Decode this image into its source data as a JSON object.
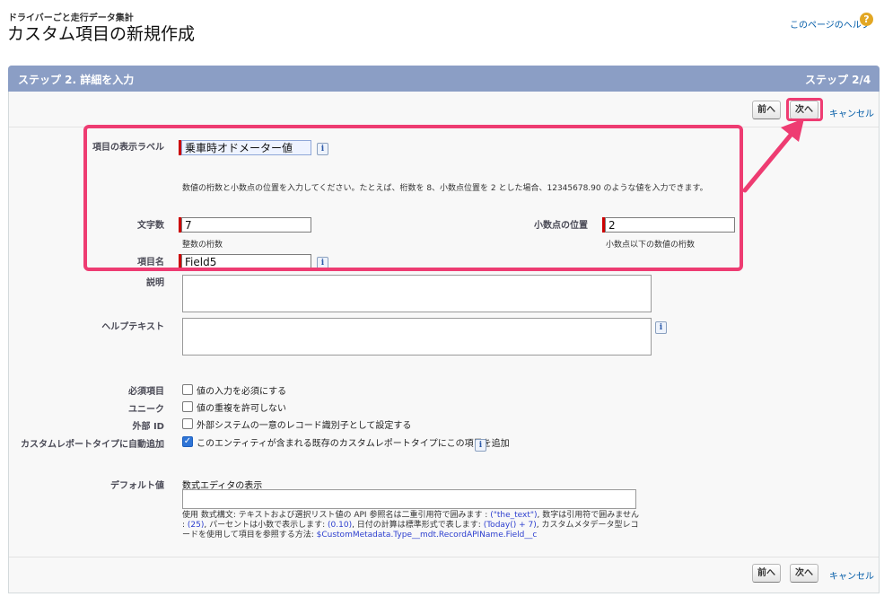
{
  "header": {
    "breadcrumb": "ドライバーごと走行データ集計",
    "title": "カスタム項目の新規作成",
    "help_link": "このページのヘルプ",
    "help_icon": "?"
  },
  "step": {
    "title": "ステップ 2. 詳細を入力",
    "counter": "ステップ 2/4"
  },
  "buttons": {
    "prev": "前へ",
    "next": "次へ",
    "cancel": "キャンセル"
  },
  "form": {
    "field_label": {
      "label": "項目の表示ラベル",
      "value": "乗車時オドメーター値"
    },
    "instruction": "数値の桁数と小数点の位置を入力してください。たとえば、桁数を 8、小数点位置を 2 とした場合、12345678.90 のような値を入力できます。",
    "length": {
      "label": "文字数",
      "value": "7",
      "note": "整数の桁数"
    },
    "decimal": {
      "label": "小数点の位置",
      "value": "2",
      "note": "小数点以下の数値の桁数"
    },
    "api_name": {
      "label": "項目名",
      "value": "Field5"
    },
    "description": {
      "label": "説明",
      "value": ""
    },
    "help_text": {
      "label": "ヘルプテキスト",
      "value": ""
    },
    "info_icon": "i",
    "required": {
      "label": "必須項目",
      "checkbox": "値の入力を必須にする",
      "checked": false
    },
    "unique": {
      "label": "ユニーク",
      "checkbox": "値の重複を許可しない",
      "checked": false
    },
    "external_id": {
      "label": "外部 ID",
      "checkbox": "外部システムの一意のレコード識別子として設定する",
      "checked": false
    },
    "report_type": {
      "label": "カスタムレポートタイプに自動追加",
      "checkbox": "このエンティティが含まれる既存のカスタムレポートタイプにこの項目を追加",
      "checked": true
    },
    "default_value": {
      "label": "デフォルト値",
      "formula_editor": "数式エディタの表示",
      "hint_1": "使用 数式構文: テキストおよび選択リスト値の API 参照名は二重引用符で囲みます : ",
      "hint_code_1": "(\"the_text\")",
      "hint_2": ", 数字は引用符で囲みません : ",
      "hint_code_2": "(25)",
      "hint_3": ", パーセントは小数で表示します: ",
      "hint_code_3": "(0.10)",
      "hint_4": ", 日付の計算は標準形式で表します: ",
      "hint_code_4": "(Today() + 7)",
      "hint_5": ", カスタムメタデータ型レコードを使用して項目を参照する方法: ",
      "hint_code_5": "$CustomMetadata.Type__mdt.RecordAPIName.Field__c"
    }
  },
  "colors": {
    "panel_header": "#8b9ec5",
    "highlight": "#ee3c72",
    "link": "#015ba7",
    "required": "#cc0000"
  }
}
